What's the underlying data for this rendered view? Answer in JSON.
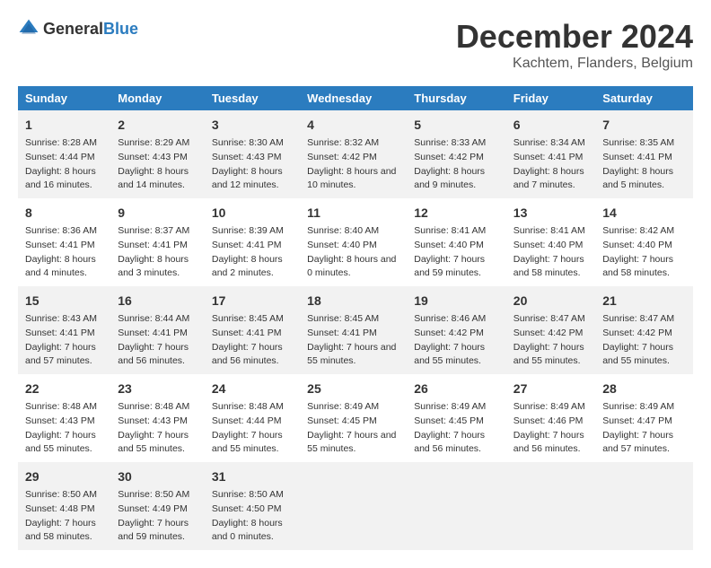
{
  "logo": {
    "text_general": "General",
    "text_blue": "Blue"
  },
  "header": {
    "main_title": "December 2024",
    "subtitle": "Kachtem, Flanders, Belgium"
  },
  "columns": [
    "Sunday",
    "Monday",
    "Tuesday",
    "Wednesday",
    "Thursday",
    "Friday",
    "Saturday"
  ],
  "weeks": [
    [
      {
        "day": "1",
        "sunrise": "Sunrise: 8:28 AM",
        "sunset": "Sunset: 4:44 PM",
        "daylight": "Daylight: 8 hours and 16 minutes."
      },
      {
        "day": "2",
        "sunrise": "Sunrise: 8:29 AM",
        "sunset": "Sunset: 4:43 PM",
        "daylight": "Daylight: 8 hours and 14 minutes."
      },
      {
        "day": "3",
        "sunrise": "Sunrise: 8:30 AM",
        "sunset": "Sunset: 4:43 PM",
        "daylight": "Daylight: 8 hours and 12 minutes."
      },
      {
        "day": "4",
        "sunrise": "Sunrise: 8:32 AM",
        "sunset": "Sunset: 4:42 PM",
        "daylight": "Daylight: 8 hours and 10 minutes."
      },
      {
        "day": "5",
        "sunrise": "Sunrise: 8:33 AM",
        "sunset": "Sunset: 4:42 PM",
        "daylight": "Daylight: 8 hours and 9 minutes."
      },
      {
        "day": "6",
        "sunrise": "Sunrise: 8:34 AM",
        "sunset": "Sunset: 4:41 PM",
        "daylight": "Daylight: 8 hours and 7 minutes."
      },
      {
        "day": "7",
        "sunrise": "Sunrise: 8:35 AM",
        "sunset": "Sunset: 4:41 PM",
        "daylight": "Daylight: 8 hours and 5 minutes."
      }
    ],
    [
      {
        "day": "8",
        "sunrise": "Sunrise: 8:36 AM",
        "sunset": "Sunset: 4:41 PM",
        "daylight": "Daylight: 8 hours and 4 minutes."
      },
      {
        "day": "9",
        "sunrise": "Sunrise: 8:37 AM",
        "sunset": "Sunset: 4:41 PM",
        "daylight": "Daylight: 8 hours and 3 minutes."
      },
      {
        "day": "10",
        "sunrise": "Sunrise: 8:39 AM",
        "sunset": "Sunset: 4:41 PM",
        "daylight": "Daylight: 8 hours and 2 minutes."
      },
      {
        "day": "11",
        "sunrise": "Sunrise: 8:40 AM",
        "sunset": "Sunset: 4:40 PM",
        "daylight": "Daylight: 8 hours and 0 minutes."
      },
      {
        "day": "12",
        "sunrise": "Sunrise: 8:41 AM",
        "sunset": "Sunset: 4:40 PM",
        "daylight": "Daylight: 7 hours and 59 minutes."
      },
      {
        "day": "13",
        "sunrise": "Sunrise: 8:41 AM",
        "sunset": "Sunset: 4:40 PM",
        "daylight": "Daylight: 7 hours and 58 minutes."
      },
      {
        "day": "14",
        "sunrise": "Sunrise: 8:42 AM",
        "sunset": "Sunset: 4:40 PM",
        "daylight": "Daylight: 7 hours and 58 minutes."
      }
    ],
    [
      {
        "day": "15",
        "sunrise": "Sunrise: 8:43 AM",
        "sunset": "Sunset: 4:41 PM",
        "daylight": "Daylight: 7 hours and 57 minutes."
      },
      {
        "day": "16",
        "sunrise": "Sunrise: 8:44 AM",
        "sunset": "Sunset: 4:41 PM",
        "daylight": "Daylight: 7 hours and 56 minutes."
      },
      {
        "day": "17",
        "sunrise": "Sunrise: 8:45 AM",
        "sunset": "Sunset: 4:41 PM",
        "daylight": "Daylight: 7 hours and 56 minutes."
      },
      {
        "day": "18",
        "sunrise": "Sunrise: 8:45 AM",
        "sunset": "Sunset: 4:41 PM",
        "daylight": "Daylight: 7 hours and 55 minutes."
      },
      {
        "day": "19",
        "sunrise": "Sunrise: 8:46 AM",
        "sunset": "Sunset: 4:42 PM",
        "daylight": "Daylight: 7 hours and 55 minutes."
      },
      {
        "day": "20",
        "sunrise": "Sunrise: 8:47 AM",
        "sunset": "Sunset: 4:42 PM",
        "daylight": "Daylight: 7 hours and 55 minutes."
      },
      {
        "day": "21",
        "sunrise": "Sunrise: 8:47 AM",
        "sunset": "Sunset: 4:42 PM",
        "daylight": "Daylight: 7 hours and 55 minutes."
      }
    ],
    [
      {
        "day": "22",
        "sunrise": "Sunrise: 8:48 AM",
        "sunset": "Sunset: 4:43 PM",
        "daylight": "Daylight: 7 hours and 55 minutes."
      },
      {
        "day": "23",
        "sunrise": "Sunrise: 8:48 AM",
        "sunset": "Sunset: 4:43 PM",
        "daylight": "Daylight: 7 hours and 55 minutes."
      },
      {
        "day": "24",
        "sunrise": "Sunrise: 8:48 AM",
        "sunset": "Sunset: 4:44 PM",
        "daylight": "Daylight: 7 hours and 55 minutes."
      },
      {
        "day": "25",
        "sunrise": "Sunrise: 8:49 AM",
        "sunset": "Sunset: 4:45 PM",
        "daylight": "Daylight: 7 hours and 55 minutes."
      },
      {
        "day": "26",
        "sunrise": "Sunrise: 8:49 AM",
        "sunset": "Sunset: 4:45 PM",
        "daylight": "Daylight: 7 hours and 56 minutes."
      },
      {
        "day": "27",
        "sunrise": "Sunrise: 8:49 AM",
        "sunset": "Sunset: 4:46 PM",
        "daylight": "Daylight: 7 hours and 56 minutes."
      },
      {
        "day": "28",
        "sunrise": "Sunrise: 8:49 AM",
        "sunset": "Sunset: 4:47 PM",
        "daylight": "Daylight: 7 hours and 57 minutes."
      }
    ],
    [
      {
        "day": "29",
        "sunrise": "Sunrise: 8:50 AM",
        "sunset": "Sunset: 4:48 PM",
        "daylight": "Daylight: 7 hours and 58 minutes."
      },
      {
        "day": "30",
        "sunrise": "Sunrise: 8:50 AM",
        "sunset": "Sunset: 4:49 PM",
        "daylight": "Daylight: 7 hours and 59 minutes."
      },
      {
        "day": "31",
        "sunrise": "Sunrise: 8:50 AM",
        "sunset": "Sunset: 4:50 PM",
        "daylight": "Daylight: 8 hours and 0 minutes."
      },
      null,
      null,
      null,
      null
    ]
  ]
}
